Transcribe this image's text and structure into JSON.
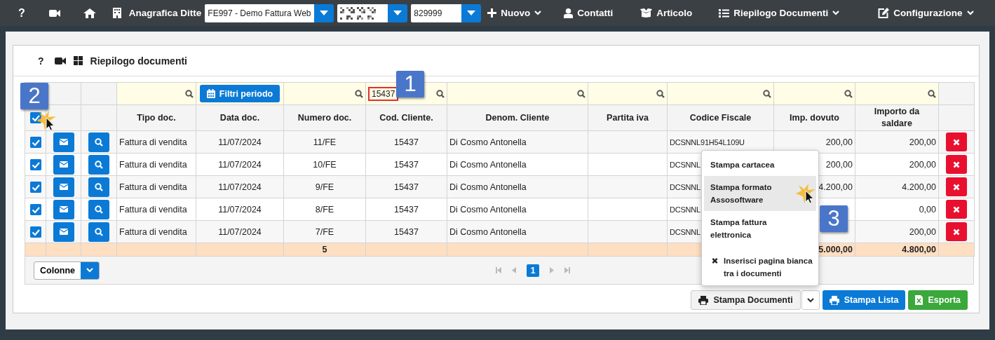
{
  "navbar": {
    "help_label": "?",
    "company_label": "Anagrafica Ditte",
    "selectors": [
      {
        "kind": "text",
        "value": "FE997 - Demo Fattura Web"
      },
      {
        "kind": "redacted"
      },
      {
        "kind": "text",
        "value": "829999"
      }
    ],
    "menus": [
      {
        "label": "Nuovo",
        "dropdown": true
      },
      {
        "label": "Contatti",
        "dropdown": false
      },
      {
        "label": "Articolo",
        "dropdown": false
      },
      {
        "label": "Riepilogo Documenti",
        "dropdown": true
      },
      {
        "label": "Configurazione",
        "dropdown": true
      }
    ]
  },
  "panel": {
    "help_label": "?",
    "title": "Riepilogo documenti"
  },
  "table": {
    "filters": [
      {
        "kind": "search"
      },
      {
        "kind": "period",
        "label": "Filtri periodo"
      },
      {
        "kind": "search"
      },
      {
        "kind": "search",
        "value": "15437",
        "highlighted": true
      },
      {
        "kind": "search"
      },
      {
        "kind": "search"
      },
      {
        "kind": "search"
      },
      {
        "kind": "search"
      },
      {
        "kind": "search"
      }
    ],
    "header_checkbox": {
      "checked": true
    },
    "columns": [
      "Tipo doc.",
      "Data doc.",
      "Numero doc.",
      "Cod. Cliente.",
      "Denom. Cliente",
      "Partita iva",
      "Codice Fiscale",
      "Imp. dovuto",
      "Importo da saldare"
    ],
    "rows": [
      {
        "checked": true,
        "cells": [
          "Fattura di vendita",
          "11/07/2024",
          "11/FE",
          "15437",
          "Di Cosmo Antonella",
          null,
          "DCSNNL91H54L109U",
          "200,00",
          "200,00"
        ]
      },
      {
        "checked": true,
        "cells": [
          "Fattura di vendita",
          "11/07/2024",
          "10/FE",
          "15437",
          "Di Cosmo Antonella",
          null,
          "DCSNNL",
          "200,00",
          "200,00"
        ]
      },
      {
        "checked": true,
        "cells": [
          "Fattura di vendita",
          "11/07/2024",
          "9/FE",
          "15437",
          "Di Cosmo Antonella",
          null,
          "DCSNNL",
          "4.200,00",
          "4.200,00"
        ]
      },
      {
        "checked": true,
        "cells": [
          "Fattura di vendita",
          "11/07/2024",
          "8/FE",
          "15437",
          "Di Cosmo Antonella",
          null,
          "DCSNNL",
          null,
          "0,00"
        ]
      },
      {
        "checked": true,
        "cells": [
          "Fattura di vendita",
          "11/07/2024",
          "7/FE",
          "15437",
          "Di Cosmo Antonella",
          null,
          "DCSNNL",
          null,
          "200,00"
        ]
      }
    ],
    "totals": {
      "numero_doc": "5",
      "imp_dovuto": "5.000,00",
      "importo_da_saldare": "4.800,00"
    }
  },
  "columns_button": {
    "label": "Colonne"
  },
  "pager": {
    "pages": [
      {
        "label": "1",
        "selected": true
      }
    ]
  },
  "print_menu": {
    "items": [
      {
        "kind": "option",
        "label": "Stampa cartacea",
        "selected": false
      },
      {
        "kind": "option",
        "label": "Stampa formato Assosoftware",
        "selected": true
      },
      {
        "kind": "option",
        "label": "Stampa fattura elettronica",
        "selected": false
      },
      {
        "kind": "toggle",
        "label": "Inserisci pagina bianca tra i documenti",
        "selected": false
      }
    ]
  },
  "actions": [
    {
      "kind": "split",
      "label": "Stampa Documenti"
    },
    {
      "kind": "primary",
      "label": "Stampa Lista"
    },
    {
      "kind": "export",
      "label": "Esporta"
    }
  ],
  "annotations": [
    {
      "label": "1"
    },
    {
      "label": "2"
    },
    {
      "label": "3"
    }
  ]
}
